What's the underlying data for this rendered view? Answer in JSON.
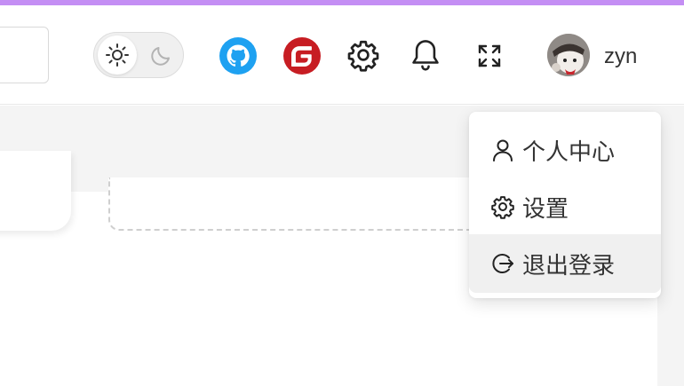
{
  "header": {
    "user": {
      "name": "zyn"
    },
    "icons": {
      "theme_light": "sun-icon",
      "theme_dark": "moon-icon",
      "github": "github-icon",
      "gitee": "gitee-icon",
      "settings": "gear-icon",
      "notifications": "bell-icon",
      "fullscreen": "fullscreen-icon"
    },
    "colors": {
      "accent_bar": "#c48ef4",
      "github": "#1ea1f1",
      "gitee": "#c71d23"
    }
  },
  "user_menu": {
    "items": [
      {
        "label": "个人中心",
        "icon": "user-icon"
      },
      {
        "label": "设置",
        "icon": "gear-icon"
      },
      {
        "label": "退出登录",
        "icon": "logout-icon",
        "active": true
      }
    ]
  }
}
